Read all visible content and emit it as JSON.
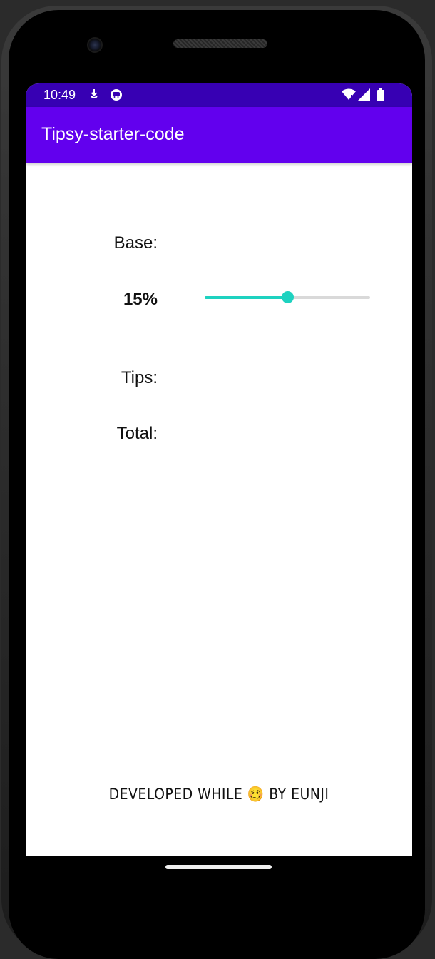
{
  "status_bar": {
    "time": "10:49",
    "icons_left": [
      "download-icon",
      "android-face-icon"
    ],
    "icons_right": [
      "wifi-icon",
      "cellular-signal-icon",
      "battery-icon"
    ],
    "color": "#3700b3"
  },
  "app_bar": {
    "title": "Tipsy-starter-code",
    "color": "#6200ee"
  },
  "form": {
    "base_label": "Base:",
    "base_value": "",
    "percent_label": "15%",
    "tip_percent": 15,
    "slider_fill_fraction": 0.5,
    "tips_label": "Tips:",
    "tips_value": "",
    "total_label": "Total:",
    "total_value": "",
    "accent_color": "#1ed2c0"
  },
  "footer": {
    "text_before": "DEVELOPED WHILE",
    "emoji": "🥴",
    "text_after": "BY EUNJI"
  }
}
